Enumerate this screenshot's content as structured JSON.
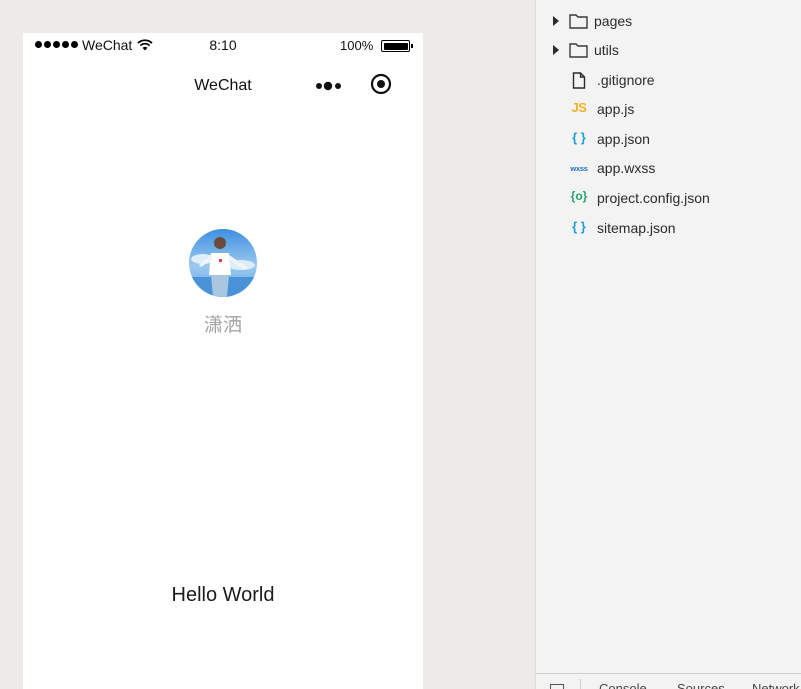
{
  "simulator": {
    "status_bar": {
      "carrier": "WeChat",
      "time": "8:10",
      "battery_percent": "100%",
      "signal_bars": 5
    },
    "nav": {
      "title": "WeChat"
    },
    "user": {
      "nickname": "潇洒"
    },
    "motto": "Hello World"
  },
  "file_tree": {
    "items": [
      {
        "type": "folder",
        "name": "pages"
      },
      {
        "type": "folder",
        "name": "utils"
      },
      {
        "type": "file",
        "name": ".gitignore",
        "icon": "file-icon"
      },
      {
        "type": "file",
        "name": "app.js",
        "icon": "js-icon",
        "badge": "JS"
      },
      {
        "type": "file",
        "name": "app.json",
        "icon": "json-icon",
        "badge": "{ }"
      },
      {
        "type": "file",
        "name": "app.wxss",
        "icon": "wxss-icon",
        "badge": "wxss"
      },
      {
        "type": "file",
        "name": "project.config.json",
        "icon": "config-json-icon",
        "badge": "{o}"
      },
      {
        "type": "file",
        "name": "sitemap.json",
        "icon": "json-icon",
        "badge": "{ }"
      }
    ]
  },
  "devtools": {
    "tabs": [
      "Console",
      "Sources",
      "Network"
    ]
  },
  "colors": {
    "js": "#f0b323",
    "json": "#1a9fd9",
    "wxss": "#1873c6",
    "config": "#1ea76a",
    "nickname": "#a3a3a3"
  }
}
